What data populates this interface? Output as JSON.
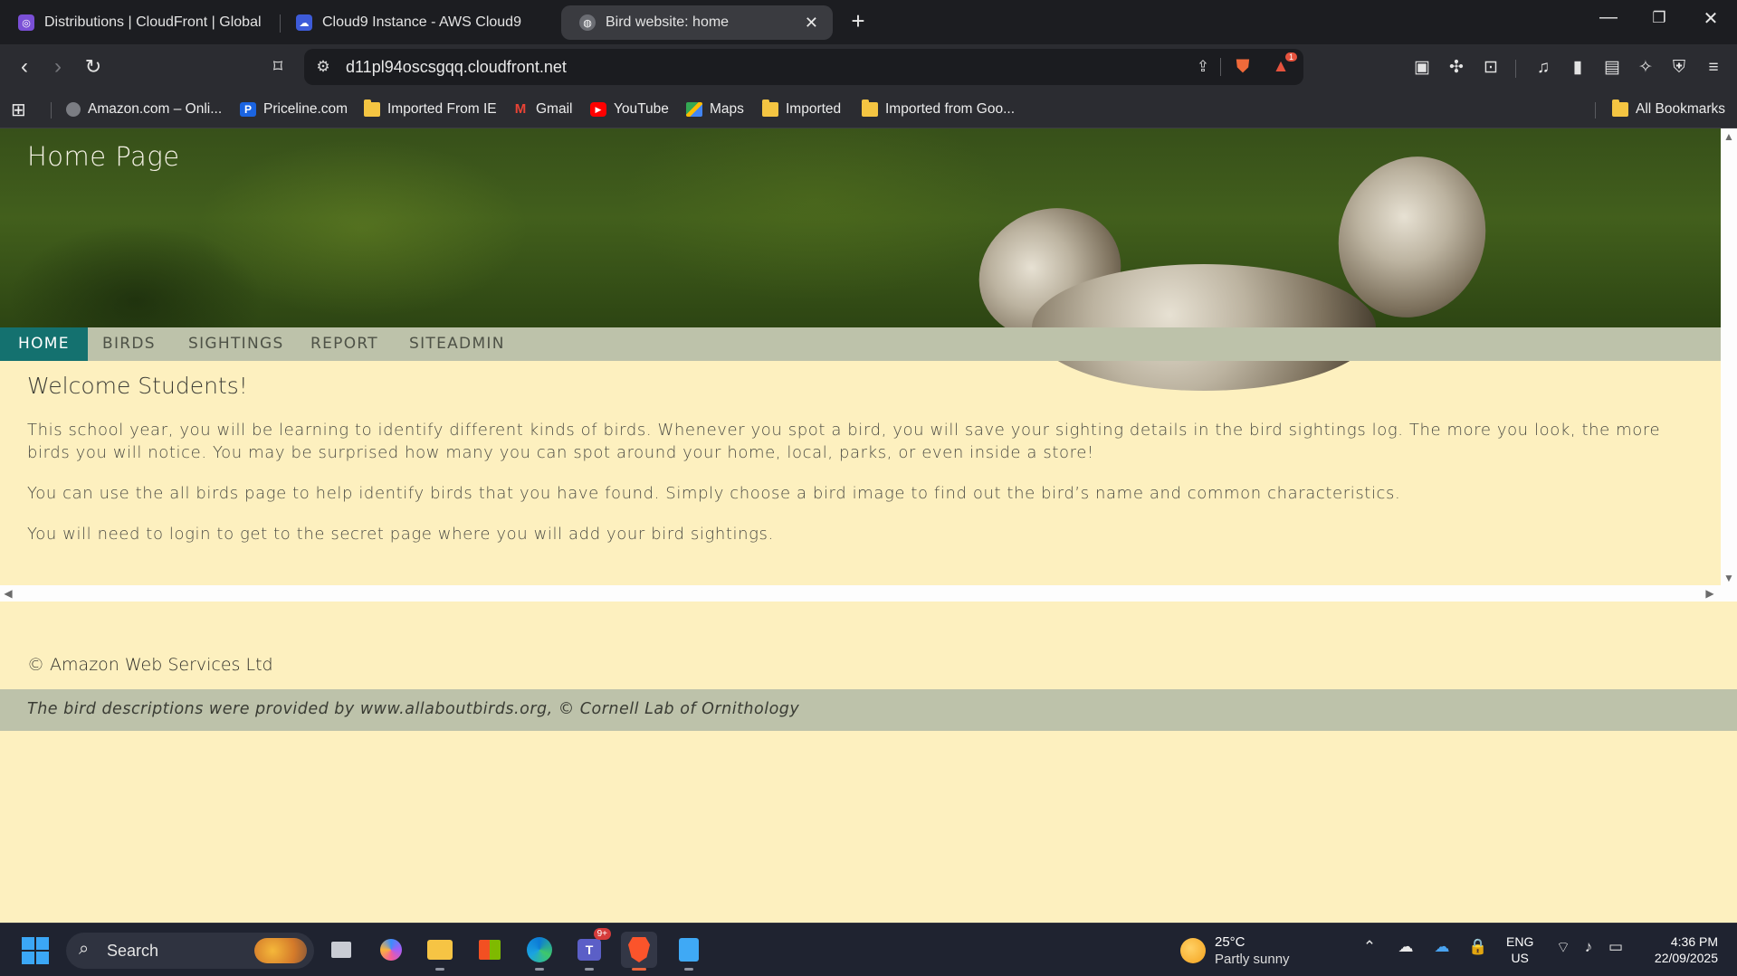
{
  "browser": {
    "tabs": [
      {
        "title": "Distributions | CloudFront | Global",
        "favicon": "cloudfront-icon",
        "color": "#7a4fd6"
      },
      {
        "title": "Cloud9 Instance - AWS Cloud9",
        "favicon": "cloud9-icon",
        "color": "#3d5bd9"
      },
      {
        "title": "Bird website: home",
        "favicon": "globe-icon",
        "color": "#8a8a8a",
        "active": true
      }
    ],
    "url": "d11pl94oscsgqq.cloudfront.net",
    "shields_badge": "1",
    "bookmarks": [
      {
        "label": "Amazon.com – Onli...",
        "icon": "globe-icon"
      },
      {
        "label": "Priceline.com",
        "icon": "priceline-icon"
      },
      {
        "label": "Imported From IE",
        "icon": "folder-icon"
      },
      {
        "label": "Gmail",
        "icon": "gmail-icon"
      },
      {
        "label": "YouTube",
        "icon": "youtube-icon"
      },
      {
        "label": "Maps",
        "icon": "maps-icon"
      },
      {
        "label": "Imported",
        "icon": "folder-icon"
      },
      {
        "label": "Imported from Goo...",
        "icon": "folder-icon"
      }
    ],
    "all_bookmarks": "All Bookmarks"
  },
  "site": {
    "title": "Home Page",
    "nav": [
      "HOME",
      "BIRDS",
      "SIGHTINGS",
      "REPORT",
      "SITEADMIN"
    ],
    "active_nav": "HOME",
    "heading": "Welcome Students!",
    "paragraphs": [
      "This school year, you will be learning to identify different kinds of birds. Whenever you spot a bird, you will save your sighting details in the bird sightings log. The more you look, the more birds you will notice. You may be surprised how many you can spot around your home, local, parks, or even inside a store!",
      "You can use the all birds page to help identify birds that you have found. Simply choose a bird image to find out the bird’s name and common characteristics.",
      "You will need to login to get to the secret page where you will add your bird sightings."
    ],
    "copyright": "© Amazon Web Services Ltd",
    "footer_note": "The bird descriptions were provided by www.allaboutbirds.org, © Cornell Lab of Ornithology",
    "colors": {
      "nav_bg": "#bdc2aa",
      "nav_active": "#14716f",
      "page_bg": "#fdf0bf"
    }
  },
  "taskbar": {
    "search_label": "Search",
    "teams_badge": "9+",
    "weather_temp": "25°C",
    "weather_desc": "Partly sunny",
    "lang_1": "ENG",
    "lang_2": "US",
    "time": "4:36 PM",
    "date": "22/09/2025"
  }
}
